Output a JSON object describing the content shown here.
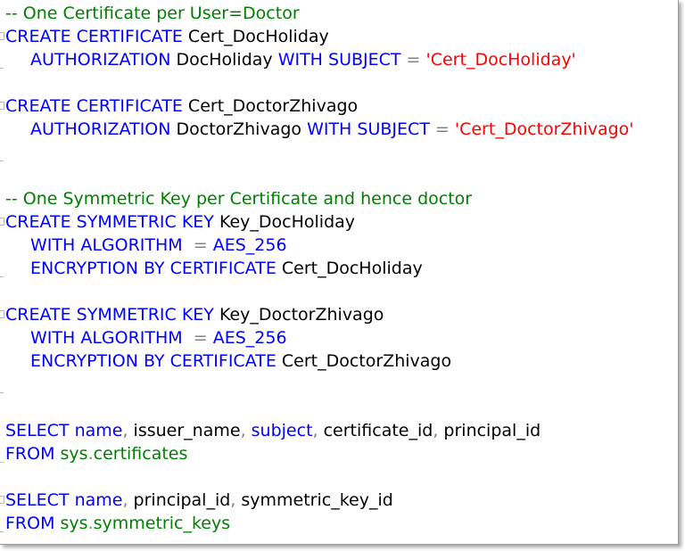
{
  "editor": {
    "lines": [
      {
        "fold": false,
        "indent": false,
        "tokens": [
          {
            "t": "comment",
            "v": "-- One Certificate per User=Doctor"
          }
        ]
      },
      {
        "fold": true,
        "indent": false,
        "tokens": [
          {
            "t": "kw",
            "v": "CREATE CERTIFICATE"
          },
          {
            "t": "id",
            "v": " Cert_DocHoliday"
          }
        ]
      },
      {
        "fold": false,
        "indent": true,
        "tokens": [
          {
            "t": "kw",
            "v": "AUTHORIZATION"
          },
          {
            "t": "id",
            "v": " DocHoliday "
          },
          {
            "t": "kw",
            "v": "WITH SUBJECT"
          },
          {
            "t": "op",
            "v": " = "
          },
          {
            "t": "str",
            "v": "'Cert_DocHoliday'"
          }
        ]
      },
      {
        "fold": false,
        "indent": false,
        "tokens": []
      },
      {
        "fold": true,
        "indent": false,
        "tokens": [
          {
            "t": "kw",
            "v": "CREATE CERTIFICATE"
          },
          {
            "t": "id",
            "v": " Cert_DoctorZhivago"
          }
        ]
      },
      {
        "fold": false,
        "indent": true,
        "tokens": [
          {
            "t": "kw",
            "v": "AUTHORIZATION"
          },
          {
            "t": "id",
            "v": " DoctorZhivago "
          },
          {
            "t": "kw",
            "v": "WITH SUBJECT"
          },
          {
            "t": "op",
            "v": " = "
          },
          {
            "t": "str",
            "v": "'Cert_DoctorZhivago'"
          }
        ]
      },
      {
        "fold": false,
        "indent": false,
        "tokens": []
      },
      {
        "fold": false,
        "indent": false,
        "tokens": []
      },
      {
        "fold": false,
        "indent": false,
        "tokens": [
          {
            "t": "comment",
            "v": "-- One Symmetric Key per Certificate and hence doctor"
          }
        ]
      },
      {
        "fold": true,
        "indent": false,
        "tokens": [
          {
            "t": "kw",
            "v": "CREATE SYMMETRIC KEY"
          },
          {
            "t": "id",
            "v": " Key_DocHoliday"
          }
        ]
      },
      {
        "fold": false,
        "indent": true,
        "tokens": [
          {
            "t": "kw",
            "v": "WITH ALGORITHM"
          },
          {
            "t": "op",
            "v": "  = "
          },
          {
            "t": "kw",
            "v": "AES_256"
          }
        ]
      },
      {
        "fold": false,
        "indent": true,
        "tokens": [
          {
            "t": "kw",
            "v": "ENCRYPTION BY CERTIFICATE"
          },
          {
            "t": "id",
            "v": " Cert_DocHoliday"
          }
        ]
      },
      {
        "fold": false,
        "indent": false,
        "tokens": []
      },
      {
        "fold": true,
        "indent": false,
        "tokens": [
          {
            "t": "kw",
            "v": "CREATE SYMMETRIC KEY"
          },
          {
            "t": "id",
            "v": " Key_DoctorZhivago"
          }
        ]
      },
      {
        "fold": false,
        "indent": true,
        "tokens": [
          {
            "t": "kw",
            "v": "WITH ALGORITHM"
          },
          {
            "t": "op",
            "v": "  = "
          },
          {
            "t": "kw",
            "v": "AES_256"
          }
        ]
      },
      {
        "fold": false,
        "indent": true,
        "tokens": [
          {
            "t": "kw",
            "v": "ENCRYPTION BY CERTIFICATE"
          },
          {
            "t": "id",
            "v": " Cert_DoctorZhivago"
          }
        ]
      },
      {
        "fold": false,
        "indent": false,
        "tokens": []
      },
      {
        "fold": false,
        "indent": false,
        "tokens": []
      },
      {
        "fold": false,
        "indent": false,
        "tokens": [
          {
            "t": "kw",
            "v": "SELECT"
          },
          {
            "t": "kw",
            "v": " name"
          },
          {
            "t": "op",
            "v": ","
          },
          {
            "t": "id",
            "v": " issuer_name"
          },
          {
            "t": "op",
            "v": ","
          },
          {
            "t": "kw",
            "v": " subject"
          },
          {
            "t": "op",
            "v": ","
          },
          {
            "t": "id",
            "v": " certificate_id"
          },
          {
            "t": "op",
            "v": ","
          },
          {
            "t": "id",
            "v": " principal_id"
          }
        ]
      },
      {
        "fold": false,
        "indent": false,
        "tokens": [
          {
            "t": "kw",
            "v": "FROM"
          },
          {
            "t": "sys",
            "v": " sys"
          },
          {
            "t": "op",
            "v": "."
          },
          {
            "t": "sys",
            "v": "certificates"
          }
        ]
      },
      {
        "fold": false,
        "indent": false,
        "tokens": []
      },
      {
        "fold": true,
        "indent": false,
        "tokens": [
          {
            "t": "kw",
            "v": "SELECT"
          },
          {
            "t": "kw",
            "v": " name"
          },
          {
            "t": "op",
            "v": ","
          },
          {
            "t": "id",
            "v": " principal_id"
          },
          {
            "t": "op",
            "v": ","
          },
          {
            "t": "id",
            "v": " symmetric_key_id"
          }
        ]
      },
      {
        "fold": false,
        "indent": false,
        "tokens": [
          {
            "t": "kw",
            "v": "FROM"
          },
          {
            "t": "sys",
            "v": " sys"
          },
          {
            "t": "op",
            "v": "."
          },
          {
            "t": "sys",
            "v": "symmetric_keys"
          }
        ]
      }
    ]
  },
  "colors": {
    "comment": "#008000",
    "keyword": "#0000ff",
    "string": "#ff0000",
    "operator": "#808080",
    "system_object": "#008000",
    "identifier": "#000000"
  }
}
